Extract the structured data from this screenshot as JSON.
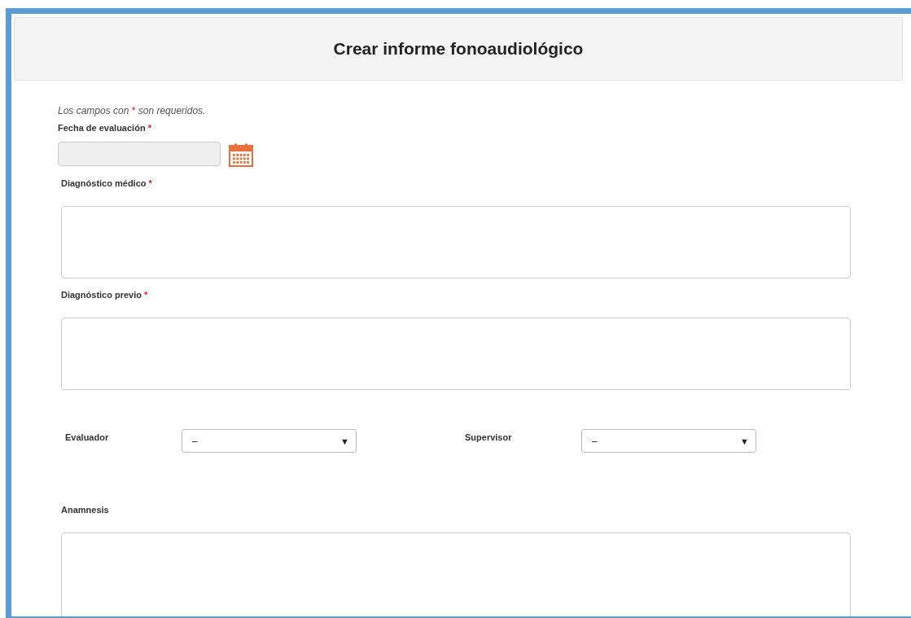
{
  "header": {
    "title": "Crear informe fonoaudiológico"
  },
  "note": {
    "before": "Los campos con",
    "mark": "*",
    "after": "son requeridos."
  },
  "fields": [
    {
      "kind": "date",
      "label": "Fecha de evaluación",
      "required": true,
      "disabled": true
    },
    {
      "kind": "textarea",
      "label": "Diagnóstico médico",
      "required": true
    },
    {
      "kind": "textarea",
      "label": "Diagnóstico previo",
      "required": true
    },
    {
      "kind": "selects",
      "items": [
        {
          "label": "Evaluador",
          "value": "–",
          "arrow": "▼"
        },
        {
          "label": "Supervisor",
          "value": "–",
          "arrow": "▼"
        }
      ]
    },
    {
      "kind": "textarea",
      "label": "Anamnesis",
      "required": false
    }
  ]
}
